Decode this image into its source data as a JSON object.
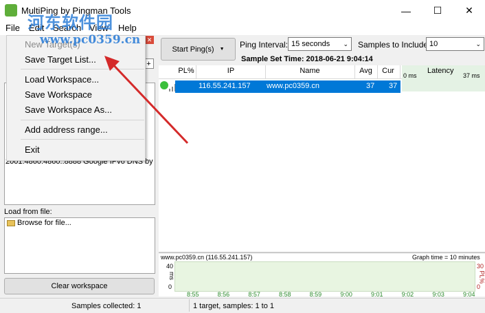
{
  "window": {
    "title": "MultiPing by Pingman Tools",
    "minimize": "—",
    "maximize": "☐",
    "close": "✕"
  },
  "watermark": {
    "line1": "河东软件园",
    "line2": "www.pc0359.cn"
  },
  "menubar": [
    "File",
    "Edit",
    "Search",
    "View",
    "Help"
  ],
  "file_menu": {
    "items": [
      {
        "label": "New Target(s)",
        "enabled": false
      },
      {
        "label": "Save Target List...",
        "enabled": true
      },
      {
        "label": "Load Workspace...",
        "enabled": true
      },
      {
        "label": "Save Workspace",
        "enabled": true
      },
      {
        "label": "Save Workspace As...",
        "enabled": true
      },
      {
        "label": "Add address range...",
        "enabled": true
      },
      {
        "label": "Exit",
        "enabled": true
      }
    ]
  },
  "left_panel": {
    "plus": "+",
    "close": "✕",
    "target_line": "2001:4860:4860::8888 Google IPv6 DNS by 1",
    "load_from_file_label": "Load from file:",
    "browse_label": "Browse for file...",
    "clear_button": "Clear workspace"
  },
  "toolbar": {
    "start_button": "Start Ping(s)",
    "ping_interval_label": "Ping Interval:",
    "ping_interval_value": "15 seconds",
    "samples_label": "Samples to Include:",
    "samples_value": "10",
    "sample_set_time": "Sample Set Time: 2018-06-21 9:04:14"
  },
  "grid": {
    "columns": [
      "PL%",
      "IP",
      "Name",
      "Avg",
      "Cur"
    ],
    "latency_header": "Latency",
    "latency_min": "0 ms",
    "latency_max": "37 ms",
    "rows": [
      {
        "ip": "116.55.241.157",
        "name": "www.pc0359.cn",
        "avg": "37",
        "cur": "37",
        "status_color": "#3bbf3b"
      }
    ]
  },
  "graph": {
    "title": "www.pc0359.cn (116.55.241.157)",
    "time_label": "Graph time = 10 minutes",
    "y_left_max": "40",
    "y_left_unit": "ms",
    "y_left_min": "0",
    "y_right_max": "30",
    "y_right_unit": "PL%",
    "y_right_min": "0",
    "times": [
      "8:55",
      "8:56",
      "8:57",
      "8:58",
      "8:59",
      "9:00",
      "9:01",
      "9:02",
      "9:03",
      "9:04"
    ]
  },
  "statusbar": {
    "samples": "Samples collected: 1",
    "targets": "1 target, samples: 1 to 1"
  },
  "colors": {
    "selection": "#0078d7",
    "arrow": "#d42a2a",
    "watermark": "#2f7fd8",
    "latency_bg": "#e4f2e4"
  }
}
